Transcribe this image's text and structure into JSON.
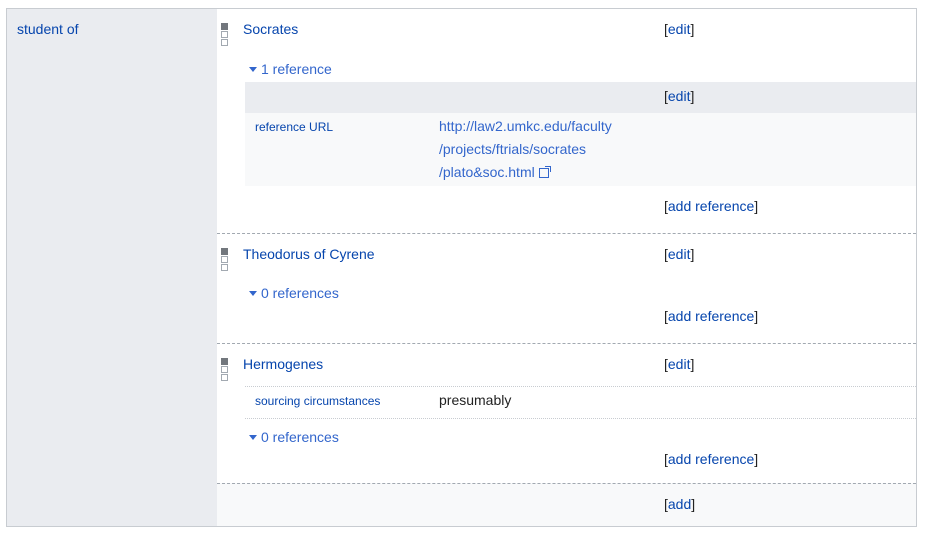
{
  "property": {
    "label": "student of"
  },
  "statements": [
    {
      "value": "Socrates",
      "edit_label": "edit",
      "refs_toggle": "1 reference",
      "reference": {
        "edit_label": "edit",
        "prop": "reference URL",
        "url_lines": [
          "http://law2.umkc.edu/faculty",
          "/projects/ftrials/socrates",
          "/plato&soc.html"
        ]
      },
      "add_ref_label": "add reference"
    },
    {
      "value": "Theodorus of Cyrene",
      "edit_label": "edit",
      "refs_toggle": "0 references",
      "add_ref_label": "add reference"
    },
    {
      "value": "Hermogenes",
      "edit_label": "edit",
      "qualifier": {
        "prop": "sourcing circumstances",
        "value": "presumably"
      },
      "refs_toggle": "0 references",
      "add_ref_label": "add reference"
    }
  ],
  "add_label": "add"
}
